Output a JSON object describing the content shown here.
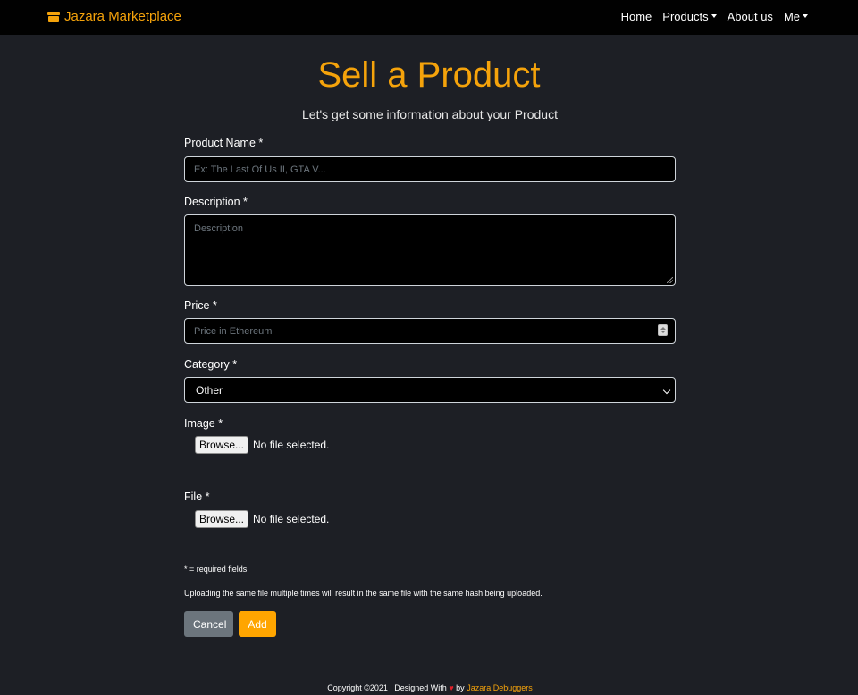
{
  "navbar": {
    "brand": "Jazara Marketplace",
    "brand_icon": "store-icon",
    "items": [
      {
        "label": "Home",
        "dropdown": false
      },
      {
        "label": "Products",
        "dropdown": true
      },
      {
        "label": "About us",
        "dropdown": false
      },
      {
        "label": "Me",
        "dropdown": true
      }
    ]
  },
  "header": {
    "title": "Sell a Product",
    "subtitle": "Let's get some information about your Product"
  },
  "form": {
    "product_name": {
      "label": "Product Name *",
      "placeholder": "Ex: The Last Of Us II, GTA V...",
      "value": ""
    },
    "description": {
      "label": "Description *",
      "placeholder": "Description",
      "value": ""
    },
    "price": {
      "label": "Price *",
      "placeholder": "Price in Ethereum",
      "value": ""
    },
    "category": {
      "label": "Category *",
      "selected": "Other"
    },
    "image": {
      "label": "Image *",
      "button": "Browse...",
      "status": "No file selected."
    },
    "file": {
      "label": "File *",
      "button": "Browse...",
      "status": "No file selected."
    },
    "required_note": "* = required fields",
    "upload_note": "Uploading the same file multiple times will result in the same file with the same hash being uploaded.",
    "cancel_label": "Cancel",
    "add_label": "Add"
  },
  "footer": {
    "prefix": "Copyright ©2021 | Designed With",
    "heart": "♥",
    "by": "by",
    "author": "Jazara Debuggers"
  },
  "colors": {
    "accent": "#f5a30b",
    "background": "#1d1f25",
    "navbar": "#010101",
    "add_button": "#ffa500",
    "cancel_button": "#6c757d"
  }
}
